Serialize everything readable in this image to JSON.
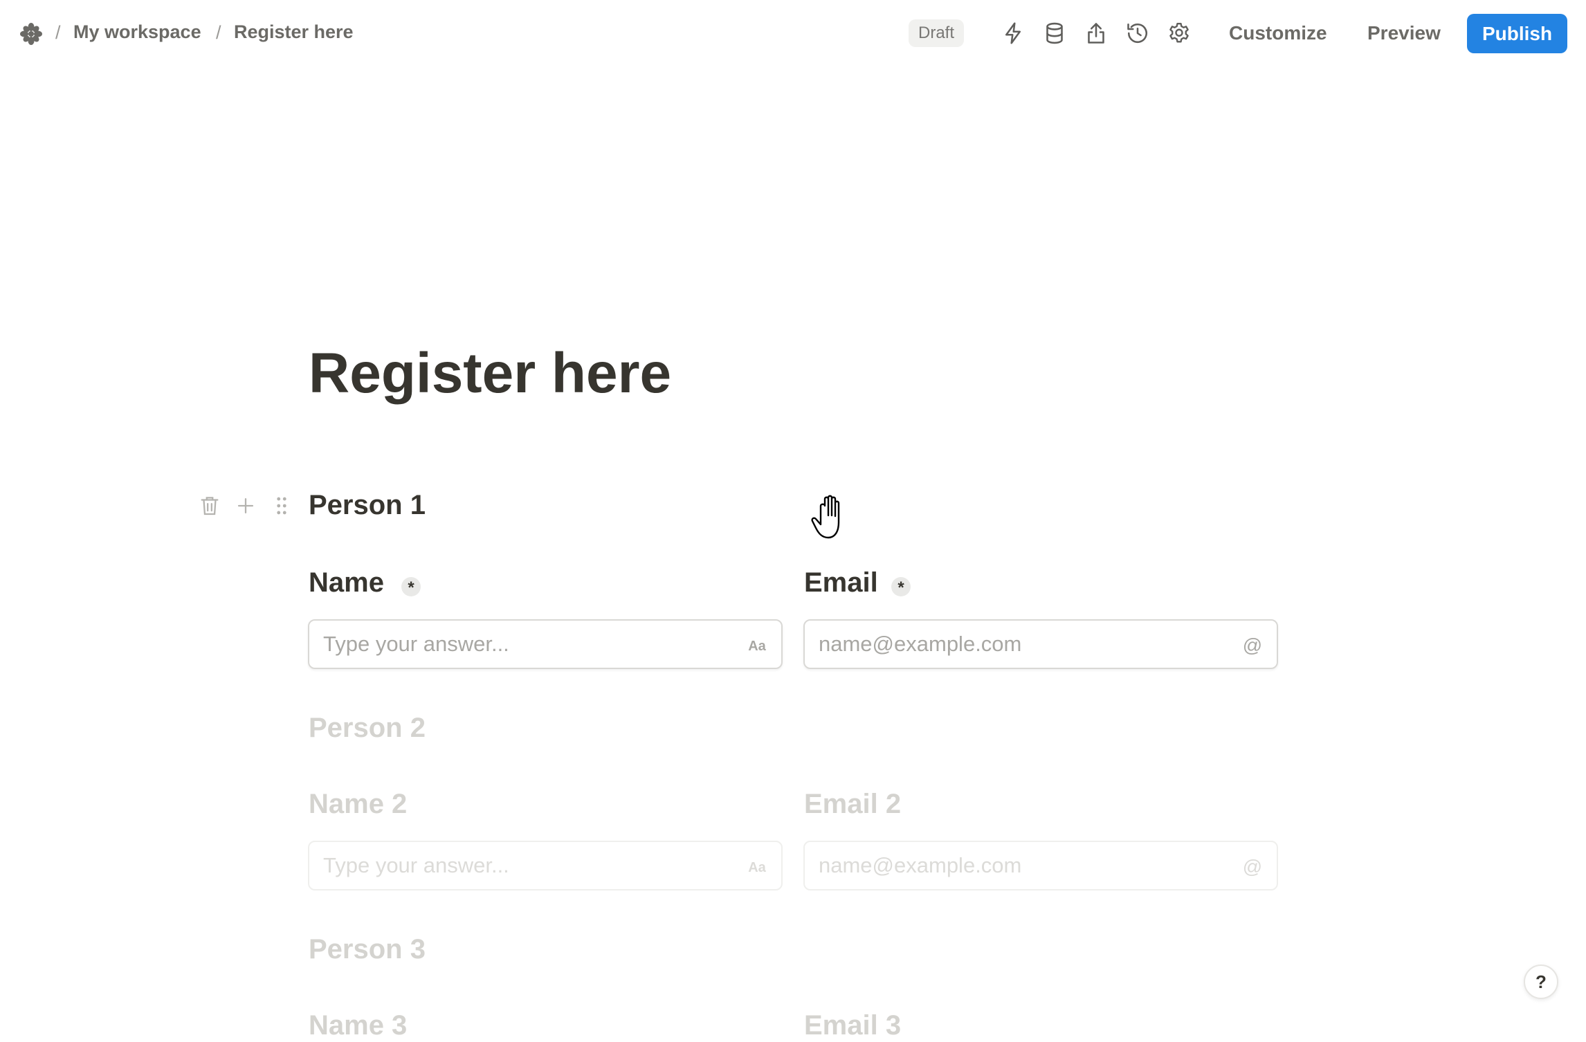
{
  "header": {
    "breadcrumb": [
      "My workspace",
      "Register here"
    ],
    "status_badge": "Draft",
    "icons": [
      "automation-bolt-icon",
      "database-icon",
      "share-icon",
      "history-icon",
      "settings-gear-icon"
    ],
    "customize_label": "Customize",
    "preview_label": "Preview",
    "publish_label": "Publish"
  },
  "form": {
    "title": "Register here",
    "sections": [
      {
        "heading": "Person 1",
        "name_label": "Name",
        "name_placeholder": "Type your answer...",
        "email_label": "Email",
        "email_placeholder": "name@example.com",
        "required_marker": "*"
      },
      {
        "heading": "Person 2",
        "name_label": "Name 2",
        "name_placeholder": "Type your answer...",
        "email_label": "Email 2",
        "email_placeholder": "name@example.com"
      },
      {
        "heading": "Person 3",
        "name_label": "Name 3",
        "email_label": "Email 3"
      }
    ],
    "text_type_hint": "Aa",
    "email_type_hint": "@"
  },
  "help_label": "?",
  "colors": {
    "accent": "#2383e2",
    "text": "#37352f",
    "muted": "#6b6a66",
    "faded": "#d4d3cf"
  }
}
